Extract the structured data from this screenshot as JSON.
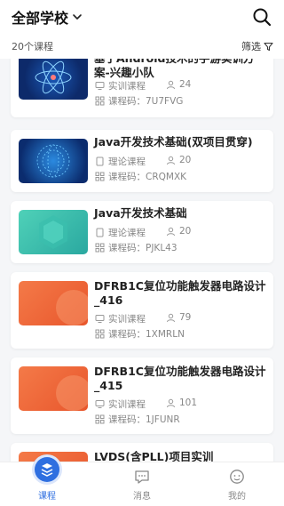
{
  "header": {
    "school": "全部学校",
    "course_count": "20个课程",
    "filter_label": "筛选"
  },
  "labels": {
    "code_prefix": "课程码："
  },
  "courses": [
    {
      "title": "基于Android技术的手游实训方案-兴趣小队",
      "type": "实训课程",
      "students": "24",
      "code": "7U7FVG"
    },
    {
      "title": "Java开发技术基础(双项目贯穿)",
      "type": "理论课程",
      "students": "20",
      "code": "CRQMXK"
    },
    {
      "title": "Java开发技术基础",
      "type": "理论课程",
      "students": "20",
      "code": "PJKL43"
    },
    {
      "title": "DFRB1C复位功能触发器电路设计_416",
      "type": "实训课程",
      "students": "79",
      "code": "1XMRLN"
    },
    {
      "title": "DFRB1C复位功能触发器电路设计_415",
      "type": "实训课程",
      "students": "101",
      "code": "1JFUNR"
    },
    {
      "title": "LVDS(含PLL)项目实训",
      "type": "",
      "students": "",
      "code": ""
    }
  ],
  "tabs": [
    {
      "label": "课程",
      "icon": "course-icon"
    },
    {
      "label": "消息",
      "icon": "message-icon"
    },
    {
      "label": "我的",
      "icon": "profile-icon"
    }
  ],
  "colors": {
    "accent": "#2f6fe0",
    "orange": "#f0693a",
    "teal": "#3cc0a8",
    "dark_blue": "#0d2a6a"
  }
}
